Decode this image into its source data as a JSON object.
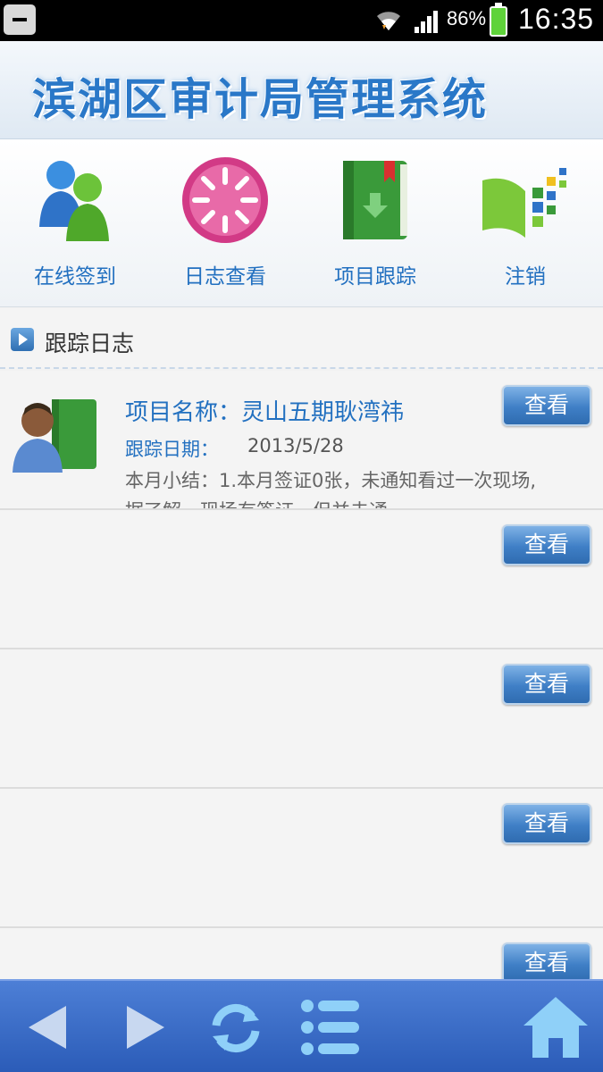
{
  "status_bar": {
    "battery": "86%",
    "time": "16:35"
  },
  "header": {
    "title": "滨湖区审计局管理系统"
  },
  "nav": [
    {
      "label": "在线签到",
      "icon": "users-icon"
    },
    {
      "label": "日志查看",
      "icon": "loading-circle-icon"
    },
    {
      "label": "项目跟踪",
      "icon": "green-book-icon"
    },
    {
      "label": "注销",
      "icon": "logout-icon"
    }
  ],
  "section": {
    "title": "跟踪日志"
  },
  "rows": [
    {
      "name": "项目名称：灵山五期耿湾祎",
      "date_label": "跟踪日期：",
      "date": "2013/5/28",
      "summary": "本月小结：1.本月签证0张，未通知看过一次现场,据了解，现场有签证，但并未通",
      "button": "查看"
    },
    {
      "name": "",
      "date_label": "",
      "date": "",
      "summary": "",
      "button": "查看"
    },
    {
      "name": "",
      "date_label": "",
      "date": "",
      "summary": "",
      "button": "查看"
    },
    {
      "name": "",
      "date_label": "",
      "date": "",
      "summary": "",
      "button": "查看"
    },
    {
      "name": "",
      "date_label": "",
      "date": "",
      "summary": "",
      "button": "查看"
    }
  ],
  "bottom_bar": [
    "back-arrow-icon",
    "forward-arrow-icon",
    "refresh-icon",
    "menu-list-icon",
    "home-icon"
  ]
}
